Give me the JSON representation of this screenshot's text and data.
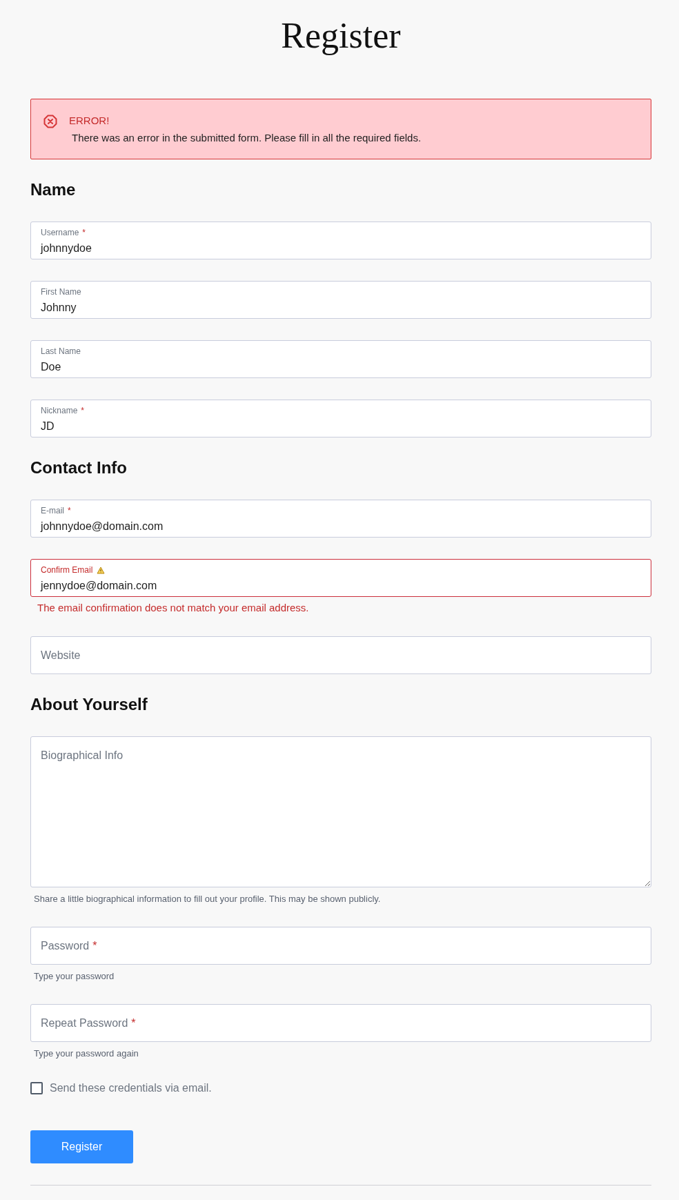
{
  "title": "Register",
  "alert": {
    "title": "ERROR!",
    "message": "There was an error in the submitted form. Please fill in all the required fields."
  },
  "sections": [
    {
      "heading": "Name",
      "fields": [
        {
          "kind": "input",
          "label": "Username",
          "required_mark": "*",
          "value": "johnnydoe",
          "invalid": false
        },
        {
          "kind": "input",
          "label": "First Name",
          "value": "Johnny",
          "invalid": false
        },
        {
          "kind": "input",
          "label": "Last Name",
          "value": "Doe",
          "invalid": false
        },
        {
          "kind": "input",
          "label": "Nickname",
          "required_mark": "*",
          "value": "JD",
          "invalid": false
        }
      ]
    },
    {
      "heading": "Contact Info",
      "fields": [
        {
          "kind": "input",
          "label": "E-mail",
          "required_mark": "*",
          "value": "johnnydoe@domain.com",
          "invalid": false
        },
        {
          "kind": "input",
          "label": "Confirm Email",
          "value": "jennydoe@domain.com",
          "invalid": true,
          "error": "The email confirmation does not match your email address."
        },
        {
          "kind": "input",
          "placeholder": "Website",
          "invalid": false
        }
      ]
    },
    {
      "heading": "About Yourself",
      "fields": [
        {
          "kind": "textarea",
          "placeholder": "Biographical Info",
          "invalid": false,
          "help": "Share a little biographical information to fill out your profile. This may be shown publicly."
        },
        {
          "kind": "input",
          "label": "Password",
          "required_mark": "*",
          "invalid": false,
          "help": "Type your password"
        },
        {
          "kind": "input",
          "label": "Repeat Password",
          "required_mark": "*",
          "invalid": false,
          "help": "Type your password again"
        }
      ]
    }
  ],
  "checkbox": {
    "label": "Send these credentials via email.",
    "checked": false
  },
  "button": "Register"
}
